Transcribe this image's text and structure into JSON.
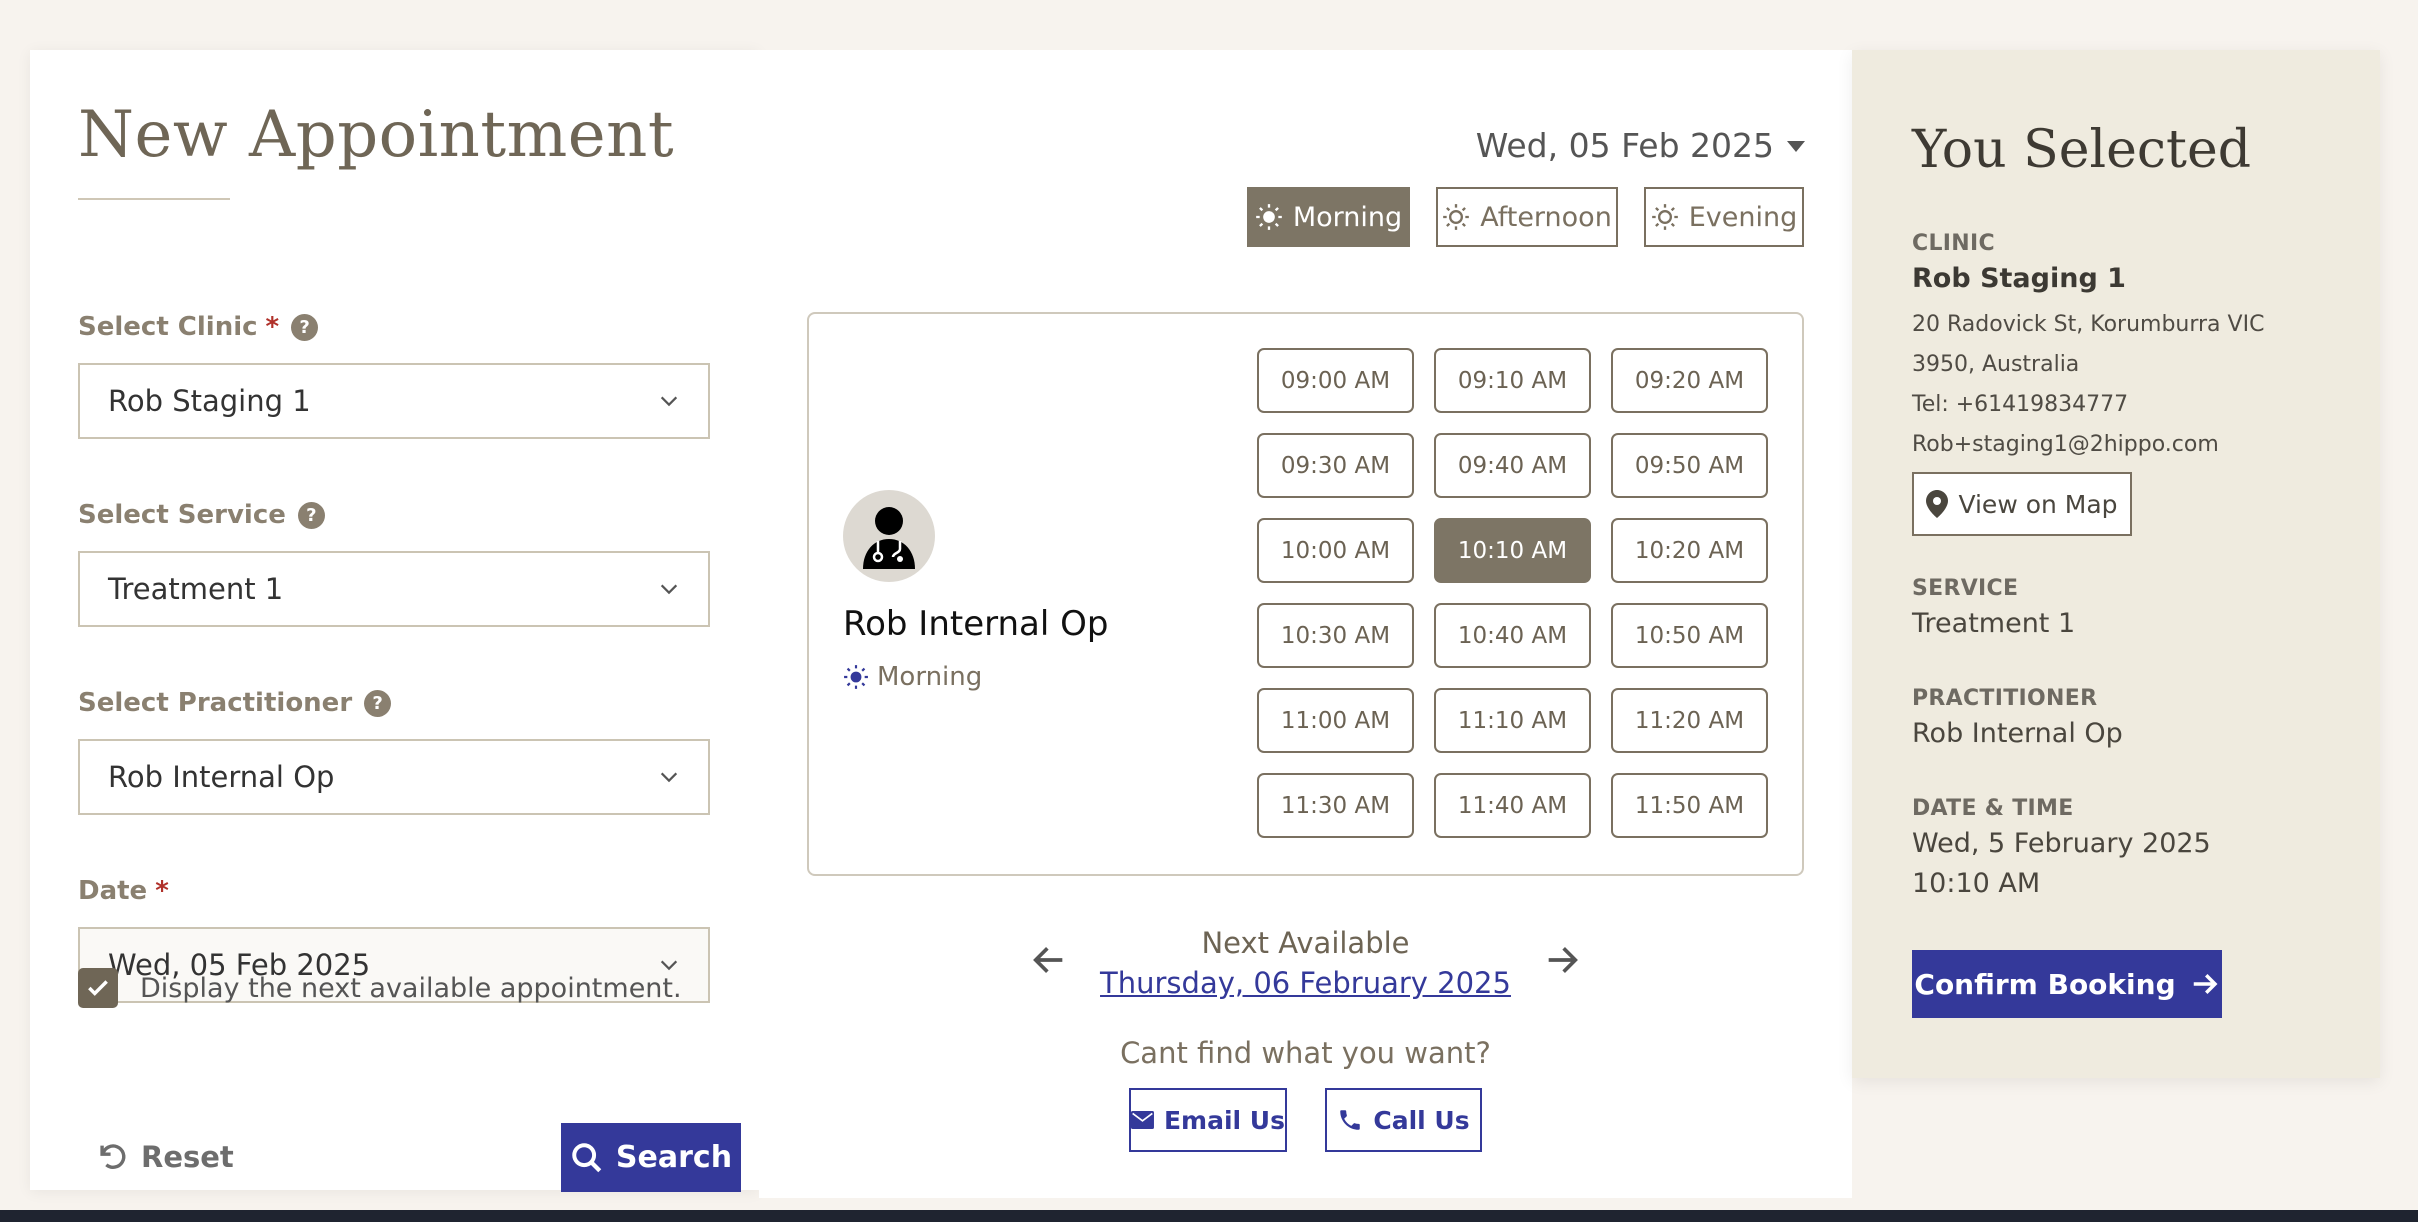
{
  "left": {
    "title": "New Appointment",
    "clinic": {
      "label": "Select Clinic",
      "required": "*",
      "help": "?",
      "value": "Rob Staging 1"
    },
    "service": {
      "label": "Select Service",
      "help": "?",
      "value": "Treatment 1"
    },
    "practitioner": {
      "label": "Select Practitioner",
      "help": "?",
      "value": "Rob Internal Op"
    },
    "date": {
      "label": "Date",
      "required": "*",
      "value": "Wed, 05 Feb 2025"
    },
    "next_available_checkbox": {
      "label": "Display the next available appointment.",
      "checked": true
    },
    "reset_label": "Reset",
    "search_label": "Search"
  },
  "middle": {
    "date_display": "Wed, 05 Feb 2025",
    "periods": [
      {
        "label": "Morning",
        "active": true
      },
      {
        "label": "Afternoon",
        "active": false
      },
      {
        "label": "Evening",
        "active": false
      }
    ],
    "practitioner_name": "Rob Internal Op",
    "practitioner_period": "Morning",
    "slots": [
      "09:00 AM",
      "09:10 AM",
      "09:20 AM",
      "09:30 AM",
      "09:40 AM",
      "09:50 AM",
      "10:00 AM",
      "10:10 AM",
      "10:20 AM",
      "10:30 AM",
      "10:40 AM",
      "10:50 AM",
      "11:00 AM",
      "11:10 AM",
      "11:20 AM",
      "11:30 AM",
      "11:40 AM",
      "11:50 AM"
    ],
    "selected_slot": "10:10 AM",
    "next_available_label": "Next Available",
    "next_available_date": "Thursday, 06 February 2025",
    "cant_find": "Cant find what you want?",
    "email_label": "Email Us",
    "call_label": "Call Us"
  },
  "right": {
    "title": "You Selected",
    "clinic_heading": "CLINIC",
    "clinic_name": "Rob Staging 1",
    "address_line1": "20 Radovick St, Korumburra VIC",
    "address_line2": "3950, Australia",
    "tel": "Tel: +61419834777",
    "email": "Rob+staging1@2hippo.com",
    "map_label": "View on Map",
    "service_heading": "SERVICE",
    "service_value": "Treatment 1",
    "practitioner_heading": "PRACTITIONER",
    "practitioner_value": "Rob Internal Op",
    "datetime_heading": "DATE & TIME",
    "date_value": "Wed, 5 February 2025",
    "time_value": "10:10 AM",
    "confirm_label": "Confirm Booking"
  },
  "colors": {
    "accent": "#34399a",
    "taupe": "#7d7565",
    "summary_bg": "#efebdf"
  }
}
